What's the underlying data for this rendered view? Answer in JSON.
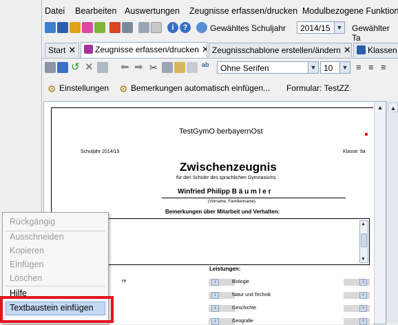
{
  "menu": [
    "Datei",
    "Bearbeiten",
    "Auswertungen",
    "Zeugnisse erfassen/drucken",
    "Modulbezogene Funktione"
  ],
  "toolbar": {
    "schoolyear_label": "Gewähltes Schuljahr",
    "schoolyear_value": "2014/15",
    "selected_label": "Gewählter Ta"
  },
  "tabs": [
    {
      "label": "Start"
    },
    {
      "label": "Zeugnisse erfassen/drucken"
    },
    {
      "label": "Zeugnisschablone erstellen/ändern"
    },
    {
      "label": "Klassen"
    }
  ],
  "editor": {
    "font_value": "Ohne Serifen",
    "size_value": "10"
  },
  "actions": {
    "settings": "Einstellungen",
    "remarks_auto": "Bemerkungen automatisch einfügen...",
    "form_label": "Formular: TestZZ"
  },
  "document": {
    "school": "TestGymO berbayernOst",
    "schoolyear": "Schuljahr 2014/15",
    "class": "Klasse: 9a",
    "title": "Zwischenzeugnis",
    "subtitle": "für den Schüler des sprachlichen Gymnasiums",
    "student": "Winfried Philipp  B ä u m l e r",
    "name_caption": "(Vorname, Familienname)",
    "remarks_heading": "Bemerkungen über Mitarbeit und Verhalten:",
    "grades_heading": "Leistungen:",
    "subjects_left": [
      "re",
      "",
      "",
      ""
    ],
    "subjects_right": [
      "Biologie",
      "Natur und Technik",
      "Geschichte",
      "Geografie"
    ]
  },
  "context_menu": [
    {
      "label": "Rückgängig",
      "enabled": false
    },
    {
      "label": "Ausschneiden",
      "enabled": false
    },
    {
      "label": "Kopieren",
      "enabled": false
    },
    {
      "label": "Einfügen",
      "enabled": false
    },
    {
      "label": "Löschen",
      "enabled": false
    },
    {
      "label": "Hilfe",
      "enabled": true
    },
    {
      "label": "Textbaustein einfügen",
      "enabled": true
    }
  ],
  "colors": {
    "highlight_frame": "#e3141c",
    "menu_highlight": "#c3d9f3"
  }
}
